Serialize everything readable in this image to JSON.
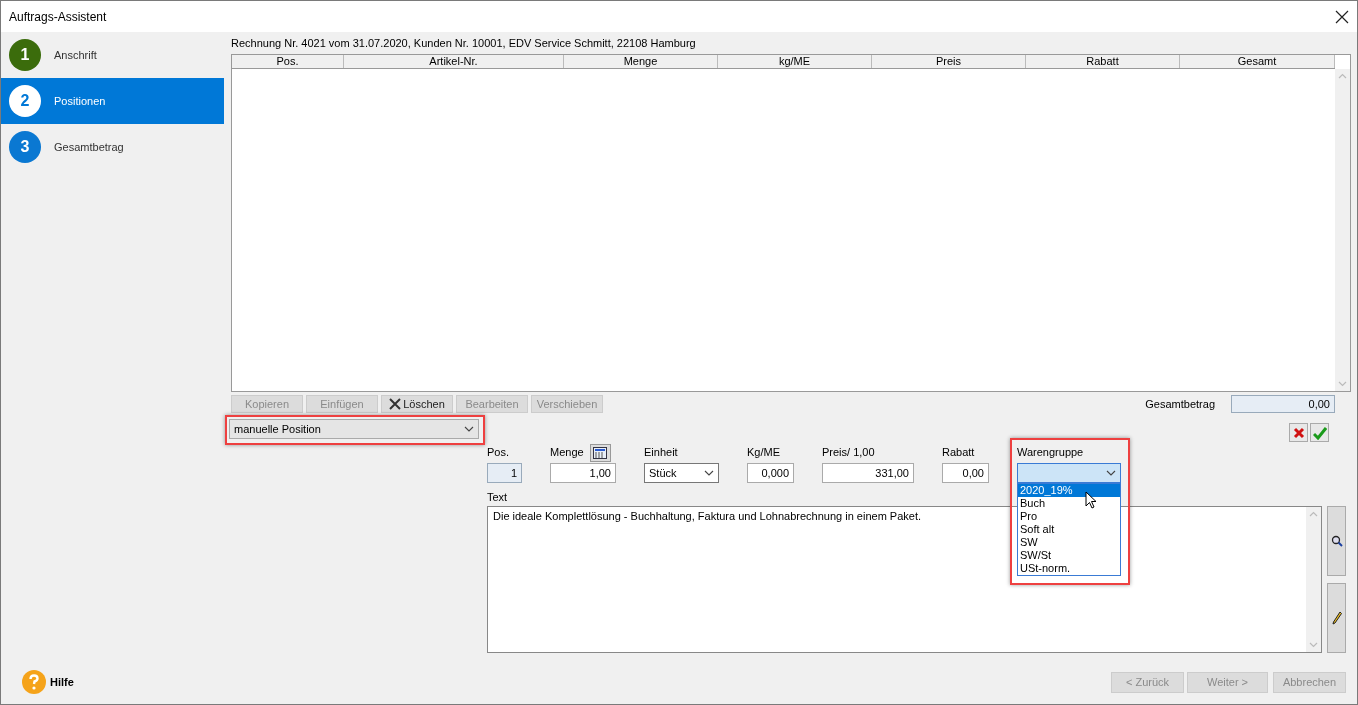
{
  "window": {
    "title": "Auftrags-Assistent"
  },
  "steps": [
    {
      "number": "1",
      "label": "Anschrift",
      "selected": false,
      "color": "#3b6c0c"
    },
    {
      "number": "2",
      "label": "Positionen",
      "selected": true,
      "color": "#0078d7"
    },
    {
      "number": "3",
      "label": "Gesamtbetrag",
      "selected": false,
      "color": "#0a78d2"
    }
  ],
  "info": "Rechnung Nr. 4021 vom 31.07.2020, Kunden Nr. 10001, EDV Service Schmitt, 22108 Hamburg",
  "table": {
    "columns": [
      "Pos.",
      "Artikel-Nr.",
      "Menge",
      "kg/ME",
      "Preis",
      "Rabatt",
      "Gesamt"
    ]
  },
  "toolbar": [
    {
      "label": "Kopieren",
      "disabled": true,
      "kind": "text"
    },
    {
      "label": "Einfügen",
      "disabled": true,
      "kind": "text"
    },
    {
      "label": "Löschen",
      "disabled": false,
      "kind": "delete"
    },
    {
      "label": "Bearbeiten",
      "disabled": true,
      "kind": "text"
    },
    {
      "label": "Verschieben",
      "disabled": true,
      "kind": "text"
    }
  ],
  "total": {
    "label": "Gesamtbetrag",
    "value": "0,00"
  },
  "position_type": {
    "value": "manuelle Position",
    "highlighted": true
  },
  "fields": [
    {
      "label": "Pos.",
      "value": "1",
      "kind": "readonly"
    },
    {
      "label": "Menge",
      "value": "1,00",
      "kind": "calc"
    },
    {
      "label": "Einheit",
      "value": "Stück",
      "kind": "select"
    },
    {
      "label": "Kg/ME",
      "value": "0,000",
      "kind": "input"
    },
    {
      "label": "Preis/ 1,00",
      "value": "331,00",
      "kind": "input"
    },
    {
      "label": "Rabatt",
      "value": "0,00",
      "kind": "input"
    }
  ],
  "warengruppe": {
    "label": "Warengruppe",
    "highlighted": true,
    "expanded": true,
    "options": [
      {
        "label": "2020_19%",
        "selected": true
      },
      {
        "label": "Buch",
        "selected": false
      },
      {
        "label": "Pro",
        "selected": false
      },
      {
        "label": "Soft alt",
        "selected": false
      },
      {
        "label": "SW",
        "selected": false
      },
      {
        "label": "SW/St",
        "selected": false
      },
      {
        "label": "USt-norm.",
        "selected": false
      }
    ]
  },
  "text": {
    "label": "Text",
    "value": "Die ideale Komplettlösung - Buchhaltung, Faktura und Lohnabrechnung in einem Paket."
  },
  "help": {
    "label": "Hilfe"
  },
  "nav_buttons": [
    {
      "label": "< Zurück",
      "disabled": true
    },
    {
      "label": "Weiter >",
      "disabled": true
    },
    {
      "label": "Abbrechen",
      "disabled": true
    }
  ]
}
